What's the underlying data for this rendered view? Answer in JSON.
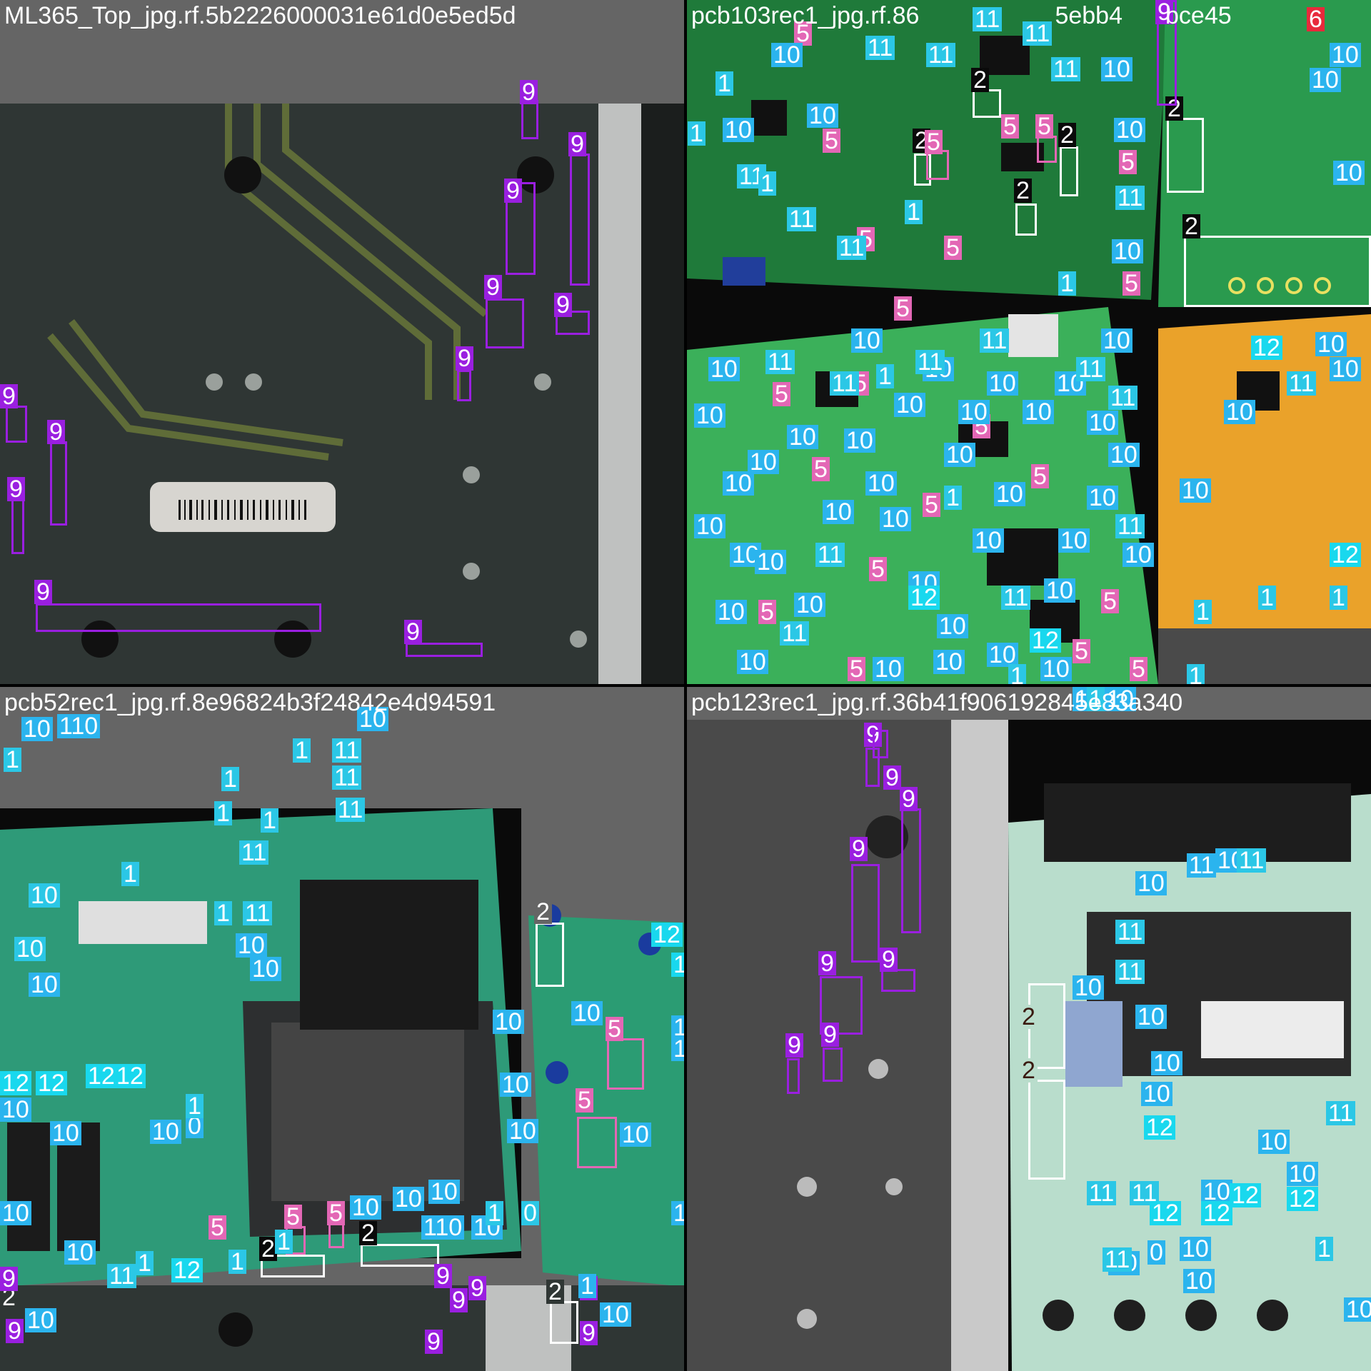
{
  "colors": {
    "class_2": "#ffffff",
    "class_5": "#e367b5",
    "class_6": "#e8293b",
    "class_9": "#9a1fe0",
    "class_10": "#2bb4ee",
    "class_11": "#2bc7e6",
    "class_12": "#19d8ee"
  },
  "tiles": [
    {
      "title": "ML365_Top_jpg.rf.5b2226000031e61d0e5ed5d",
      "theme": "gray-pcb",
      "visible_labels": [
        "9"
      ]
    },
    {
      "title": "pcb103rec1_jpg.rf.86",
      "title_tail": "5ebb4",
      "title_end": "bce45",
      "theme": "green-pcb",
      "visible_labels": [
        "1",
        "2",
        "5",
        "6",
        "10",
        "11",
        "12"
      ]
    },
    {
      "title": "pcb52rec1_jpg.rf.8e96824b3f24842e4d94591",
      "theme": "green-pcb",
      "visible_labels": [
        "1",
        "2",
        "5",
        "9",
        "10",
        "11",
        "12"
      ]
    },
    {
      "title": "pcb123rec1_jpg.rf.36b41f906192845e83a340",
      "theme": "gray-pcb",
      "visible_labels": [
        "1",
        "2",
        "9",
        "10",
        "11",
        "12"
      ]
    }
  ]
}
